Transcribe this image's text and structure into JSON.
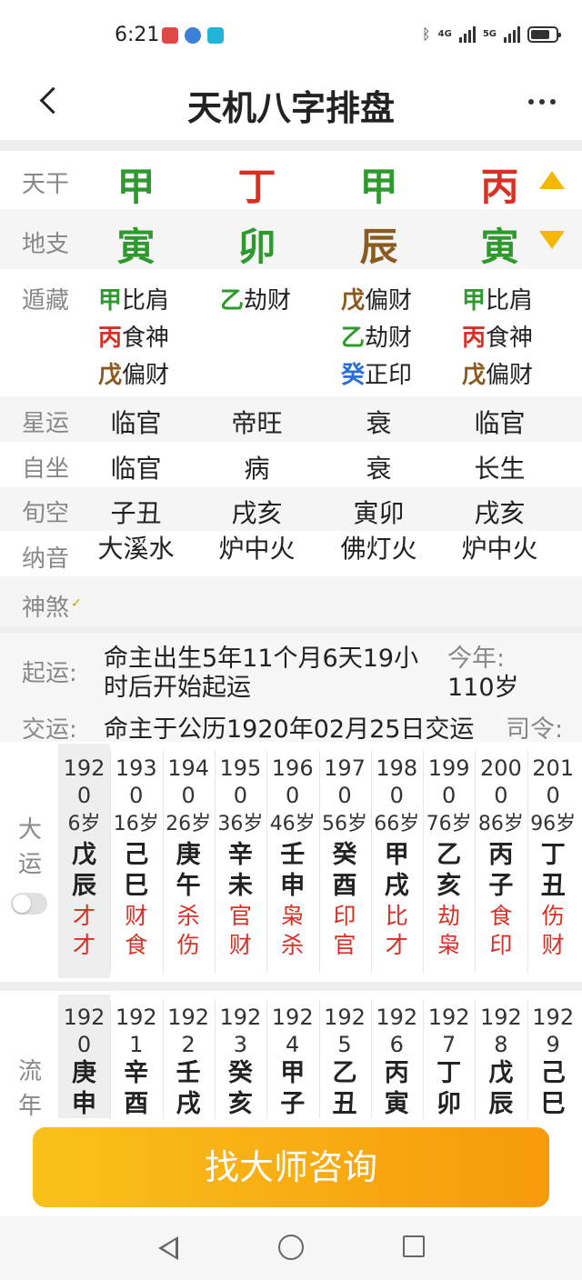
{
  "status": {
    "time": "6:21",
    "net1": "4G",
    "net2": "5G"
  },
  "header": {
    "title": "天机八字排盘"
  },
  "labels": {
    "tiangan": "天干",
    "dizhi": "地支",
    "canggan": "遁藏",
    "xingyun": "星运",
    "zizuo": "自坐",
    "xunkong": "旬空",
    "nayin": "纳音",
    "shensha": "神煞",
    "qiyun": "起运:",
    "jiaoyun": "交运:",
    "dayun": "大运",
    "liunian": "流年"
  },
  "tiangan": [
    "甲",
    "丁",
    "甲",
    "丙"
  ],
  "dizhi": [
    "寅",
    "卯",
    "辰",
    "寅"
  ],
  "canggan": [
    [
      {
        "g": "甲",
        "t": "比肩"
      },
      {
        "g": "丙",
        "t": "食神"
      },
      {
        "g": "戊",
        "t": "偏财"
      }
    ],
    [
      {
        "g": "乙",
        "t": "劫财"
      }
    ],
    [
      {
        "g": "戊",
        "t": "偏财"
      },
      {
        "g": "乙",
        "t": "劫财"
      },
      {
        "g": "癸",
        "t": "正印"
      }
    ],
    [
      {
        "g": "甲",
        "t": "比肩"
      },
      {
        "g": "丙",
        "t": "食神"
      },
      {
        "g": "戊",
        "t": "偏财"
      }
    ]
  ],
  "xingyun": [
    "临官",
    "帝旺",
    "衰",
    "临官"
  ],
  "zizuo": [
    "临官",
    "病",
    "衰",
    "长生"
  ],
  "xunkong": [
    "子丑",
    "戌亥",
    "寅卯",
    "戌亥"
  ],
  "nayin": [
    "大溪水",
    "炉中火",
    "佛灯火",
    "炉中火"
  ],
  "qiyun": {
    "line1": "命主出生5年11个月6天19小",
    "line2": "时后开始起运",
    "thisyear_label": "今年:",
    "age": "110岁",
    "jiaoyun": "命主于公历1920年02月25日交运",
    "siling": "司令:"
  },
  "dayun": [
    {
      "y1": "192",
      "y2": "0",
      "age": "6岁",
      "g": "戊",
      "z": "辰",
      "s1": "才",
      "s2": "才"
    },
    {
      "y1": "193",
      "y2": "0",
      "age": "16岁",
      "g": "己",
      "z": "巳",
      "s1": "财",
      "s2": "食"
    },
    {
      "y1": "194",
      "y2": "0",
      "age": "26岁",
      "g": "庚",
      "z": "午",
      "s1": "杀",
      "s2": "伤"
    },
    {
      "y1": "195",
      "y2": "0",
      "age": "36岁",
      "g": "辛",
      "z": "未",
      "s1": "官",
      "s2": "财"
    },
    {
      "y1": "196",
      "y2": "0",
      "age": "46岁",
      "g": "壬",
      "z": "申",
      "s1": "枭",
      "s2": "杀"
    },
    {
      "y1": "197",
      "y2": "0",
      "age": "56岁",
      "g": "癸",
      "z": "酉",
      "s1": "印",
      "s2": "官"
    },
    {
      "y1": "198",
      "y2": "0",
      "age": "66岁",
      "g": "甲",
      "z": "戌",
      "s1": "比",
      "s2": "才"
    },
    {
      "y1": "199",
      "y2": "0",
      "age": "76岁",
      "g": "乙",
      "z": "亥",
      "s1": "劫",
      "s2": "枭"
    },
    {
      "y1": "200",
      "y2": "0",
      "age": "86岁",
      "g": "丙",
      "z": "子",
      "s1": "食",
      "s2": "印"
    },
    {
      "y1": "201",
      "y2": "0",
      "age": "96岁",
      "g": "丁",
      "z": "丑",
      "s1": "伤",
      "s2": "财"
    }
  ],
  "liunian": [
    {
      "y1": "192",
      "y2": "0",
      "g": "庚",
      "z": "申"
    },
    {
      "y1": "192",
      "y2": "1",
      "g": "辛",
      "z": "酉"
    },
    {
      "y1": "192",
      "y2": "2",
      "g": "壬",
      "z": "戌"
    },
    {
      "y1": "192",
      "y2": "3",
      "g": "癸",
      "z": "亥"
    },
    {
      "y1": "192",
      "y2": "4",
      "g": "甲",
      "z": "子"
    },
    {
      "y1": "192",
      "y2": "5",
      "g": "乙",
      "z": "丑"
    },
    {
      "y1": "192",
      "y2": "6",
      "g": "丙",
      "z": "寅"
    },
    {
      "y1": "192",
      "y2": "7",
      "g": "丁",
      "z": "卯"
    },
    {
      "y1": "192",
      "y2": "8",
      "g": "戊",
      "z": "辰"
    },
    {
      "y1": "192",
      "y2": "9",
      "g": "己",
      "z": "巳"
    }
  ],
  "cta": {
    "label": "找大师咨询"
  },
  "colors": {
    "wood": "#2e9a2e",
    "fire": "#d93025",
    "earth": "#8b5a1e",
    "water": "#2a6fd6",
    "accent": "#f5b800"
  }
}
